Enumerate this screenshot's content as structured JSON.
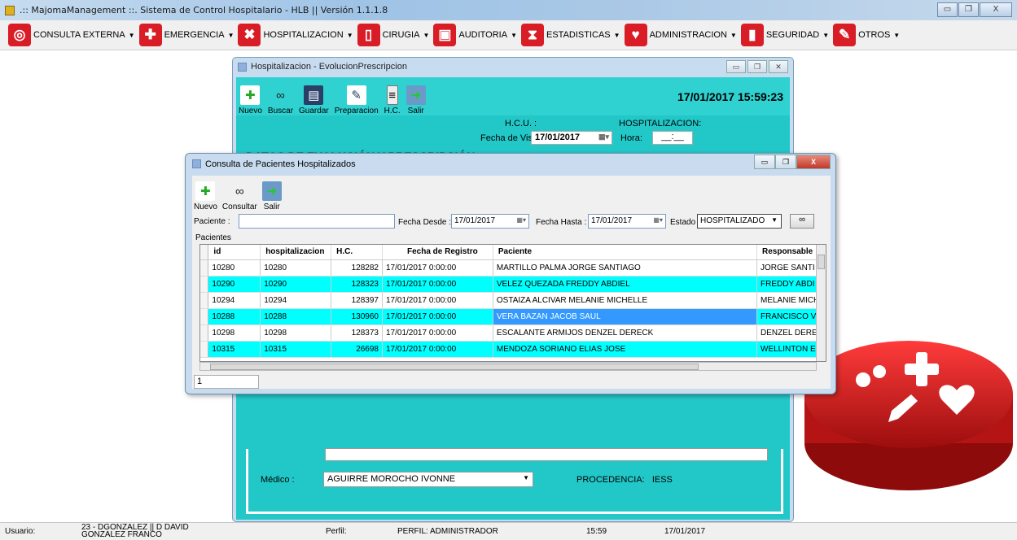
{
  "app": {
    "title": ".:: MajomaManagement ::. Sistema de Control Hospitalario - HLB || Versión 1.1.1.8",
    "window_buttons": [
      "▭",
      "❐",
      "X"
    ]
  },
  "menu": [
    {
      "label": "CONSULTA EXTERNA",
      "icon": "pill-icon",
      "color": "#d91d26",
      "glyph": "◎"
    },
    {
      "label": "EMERGENCIA",
      "icon": "first-aid-icon",
      "color": "#d91d26",
      "glyph": "✚"
    },
    {
      "label": "HOSPITALIZACION",
      "icon": "syringe-icon",
      "color": "#d91d26",
      "glyph": "✖"
    },
    {
      "label": "CIRUGIA",
      "icon": "clipboard-icon",
      "color": "#d91d26",
      "glyph": "▯"
    },
    {
      "label": "AUDITORIA",
      "icon": "medkit-icon",
      "color": "#d91d26",
      "glyph": "▣"
    },
    {
      "label": "ESTADISTICAS",
      "icon": "hourglass-icon",
      "color": "#d91d26",
      "glyph": "⧗"
    },
    {
      "label": "ADMINISTRACION",
      "icon": "heartbeat-icon",
      "color": "#d91d26",
      "glyph": "♥"
    },
    {
      "label": "SEGURIDAD",
      "icon": "bottle-icon",
      "color": "#d91d26",
      "glyph": "▮"
    },
    {
      "label": "OTROS",
      "icon": "injection-icon",
      "color": "#d91d26",
      "glyph": "✎"
    }
  ],
  "hosp": {
    "title": "Hospitalizacion - EvolucionPrescripcion",
    "toolbar": {
      "nuevo": "Nuevo",
      "buscar": "Buscar",
      "guardar": "Guardar",
      "preparacion": "Preparacion",
      "hc": "H.C.",
      "salir": "Salir"
    },
    "datetime": "17/01/2017  15:59:23",
    "hcu_label": "H.C.U. :",
    "hosp_label": "HOSPITALIZACION:",
    "fecha_visita_label": "Fecha de Visita:",
    "fecha_visita": "17/01/2017",
    "hora_label": "Hora:",
    "hora_value": "__:__",
    "section_title": "DATOS DE EVOLUCIÓN Y PRESCRIPCIÓN",
    "medico_label": "Médico :",
    "medico_value": "AGUIRRE MOROCHO IVONNE",
    "procedencia_label": "PROCEDENCIA:",
    "procedencia_value": "IESS"
  },
  "dialog": {
    "title": "Consulta de Pacientes Hospitalizados",
    "toolbar": {
      "nuevo": "Nuevo",
      "consultar": "Consultar",
      "salir": "Salir"
    },
    "paciente_label": "Paciente :",
    "paciente_value": "",
    "fecha_desde_label": "Fecha Desde :",
    "fecha_desde": "17/01/2017",
    "fecha_hasta_label": "Fecha Hasta :",
    "fecha_hasta": "17/01/2017",
    "estado_label": "Estado :",
    "estado_value": "HOSPITALIZADO",
    "group_label": "Pacientes",
    "columns": [
      "id",
      "hospitalizacion",
      "H.C.",
      "Fecha de Registro",
      "Paciente",
      "Responsable"
    ],
    "rows": [
      {
        "id": "10280",
        "hosp": "10280",
        "hc": "128282",
        "fecha": "17/01/2017 0:00:00",
        "paciente": "MARTILLO PALMA JORGE SANTIAGO",
        "resp": "JORGE SANTI"
      },
      {
        "id": "10290",
        "hosp": "10290",
        "hc": "128323",
        "fecha": "17/01/2017 0:00:00",
        "paciente": "VELEZ QUEZADA FREDDY ABDIEL",
        "resp": "FREDDY ABDI"
      },
      {
        "id": "10294",
        "hosp": "10294",
        "hc": "128397",
        "fecha": "17/01/2017 0:00:00",
        "paciente": "OSTAIZA ALCIVAR MELANIE MICHELLE",
        "resp": "MELANIE MICH"
      },
      {
        "id": "10288",
        "hosp": "10288",
        "hc": "130960",
        "fecha": "17/01/2017 0:00:00",
        "paciente": "VERA BAZAN JACOB SAUL",
        "resp": "FRANCISCO VI"
      },
      {
        "id": "10298",
        "hosp": "10298",
        "hc": "128373",
        "fecha": "17/01/2017 0:00:00",
        "paciente": "ESCALANTE ARMIJOS DENZEL DERECK",
        "resp": "DENZEL DERE"
      },
      {
        "id": "10315",
        "hosp": "10315",
        "hc": "26698",
        "fecha": "17/01/2017 0:00:00",
        "paciente": "MENDOZA SORIANO ELIAS JOSE",
        "resp": "WELLINTON E"
      }
    ],
    "record_count": "1"
  },
  "status": {
    "usuario_label": "Usuario:",
    "usuario_value": "23 - DGONZALEZ || D DAVID GONZALEZ FRANCO",
    "perfil_label": "Perfil:",
    "perfil_value": "PERFIL: ADMINISTRADOR",
    "time": "15:59",
    "date": "17/01/2017"
  },
  "colors": {
    "accent_cyan": "#22c8c8",
    "row_highlight": "#00ffff",
    "row_selected": "#3399ff",
    "brand_red": "#d91d26"
  }
}
